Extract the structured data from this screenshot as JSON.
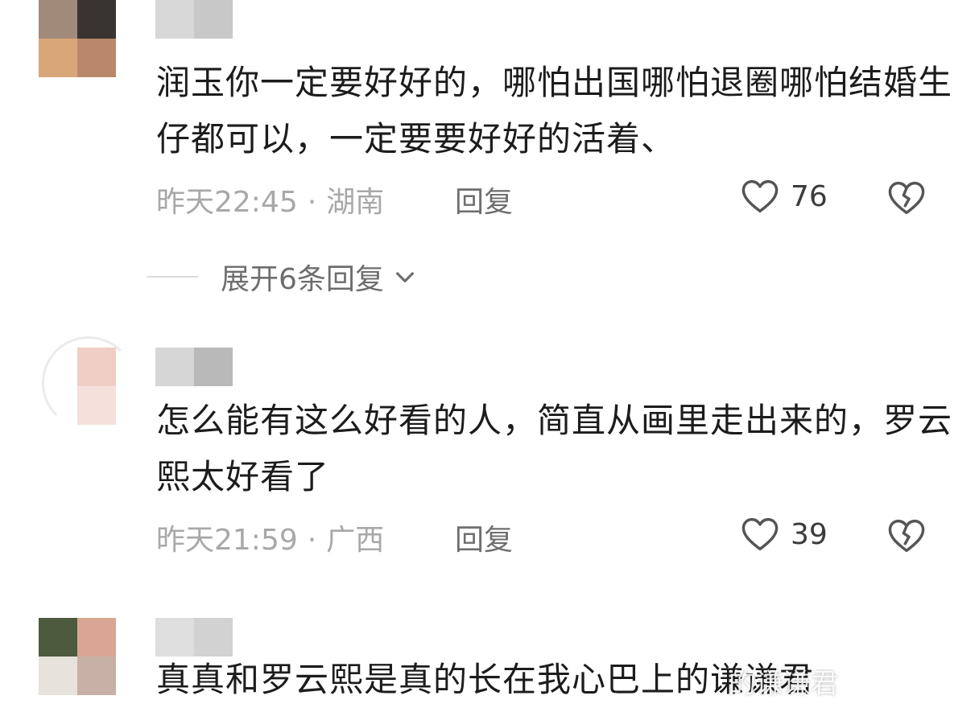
{
  "comments": [
    {
      "text": "润玉你一定要好好的，哪怕出国哪怕退圈哪怕结婚生仔都可以，一定要要好好的活着、",
      "time": "昨天22:45",
      "location": "湖南",
      "reply_label": "回复",
      "likes": "76",
      "avatar_colors": [
        "#a08b7b",
        "#3a3431",
        "#d9a679",
        "#b9886c"
      ],
      "username_colors": [
        "#d8d8d8",
        "#c8c8c8"
      ]
    },
    {
      "text": "怎么能有这么好看的人，简直从画里走出来的，罗云熙太好看了",
      "time": "昨天21:59",
      "location": "广西",
      "reply_label": "回复",
      "likes": "39",
      "avatar_colors": [
        "#ffffff",
        "#efcfc5",
        "#ffffff",
        "#f6e0dc"
      ],
      "username_colors": [
        "#d6d6d6",
        "#b9b9b9"
      ]
    },
    {
      "text": "真真和罗云熙是真的长在我心巴上的谦谦君",
      "avatar_colors": [
        "#4d5a3e",
        "#d9a695",
        "#e7e2db",
        "#c7b0a5"
      ],
      "username_colors": [
        "#dedede",
        "#d2d2d2"
      ]
    }
  ],
  "expand_replies": "展开6条回复",
  "watermark": "的谦谦君",
  "colors": {
    "meta_gray": "#a8a8a8",
    "text_dark": "#1c1c1c",
    "icon_gray": "#555555"
  },
  "icons": [
    "heart-outline-icon",
    "broken-heart-icon",
    "chevron-down-icon"
  ]
}
